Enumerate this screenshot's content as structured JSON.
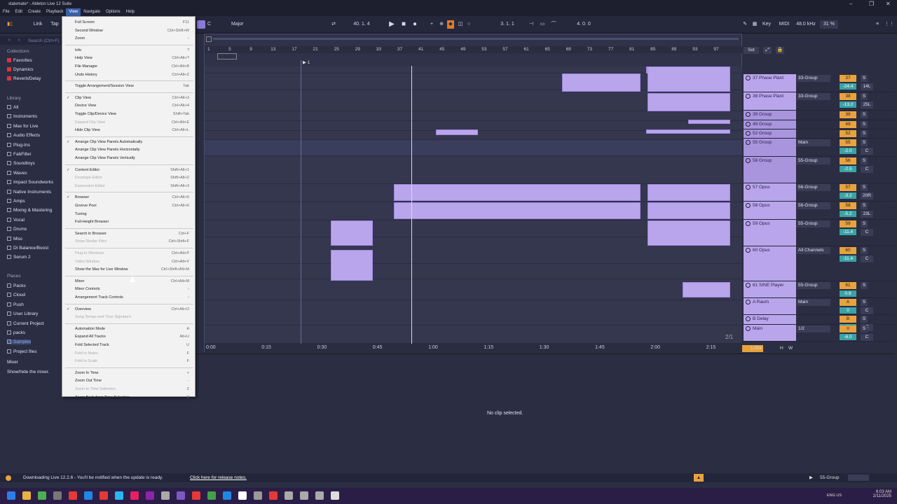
{
  "titlebar": {
    "title": "stalemate* - Ableton Live 12 Suite",
    "min": "–",
    "max": "❐",
    "close": "✕"
  },
  "menubar": [
    "File",
    "Edit",
    "Create",
    "Playback",
    "View",
    "Navigate",
    "Options",
    "Help"
  ],
  "toolbar": {
    "link": "Link",
    "tap": "Tap",
    "key": "C",
    "scale": "Major",
    "position": "40. 1. 4",
    "loop_start": "3. 1. 1",
    "loop_length": "4. 0. 0",
    "key_label": "Key",
    "midi_label": "MIDI",
    "sample_rate": "48.0 kHz",
    "cpu": "31 %"
  },
  "browser": {
    "search_placeholder": "Search (Ctrl+F)",
    "collections_header": "Collections",
    "collections": [
      {
        "label": "Favorites",
        "color": "#e0333a"
      },
      {
        "label": "Dynamics",
        "color": "#e0333a"
      },
      {
        "label": "Reverb/Delay",
        "color": "#e0333a"
      }
    ],
    "library_header": "Library",
    "library": [
      "All",
      "Instruments",
      "Max for Live",
      "Audio Effects",
      "Plug-Ins",
      "FabFilter",
      "Soundtoys",
      "Waves",
      "Impact Soundworks",
      "Native Instruments",
      "Amps",
      "Mixing & Mastering",
      "Vocal",
      "Drums",
      "Misc",
      "DI Balance/Boost",
      "Serum 2"
    ],
    "places_header": "Places",
    "places": [
      "Packs",
      "Cloud",
      "Push",
      "User Library",
      "Current Project",
      "packs",
      "Samples",
      "Project files"
    ],
    "mixer_header": "Mixer",
    "mixer_text": "Show/hide the mixer."
  },
  "ruler": {
    "bars": [
      "1",
      "5",
      "9",
      "13",
      "17",
      "21",
      "25",
      "29",
      "33",
      "37",
      "41",
      "45",
      "49",
      "53",
      "57",
      "61",
      "65",
      "69",
      "73",
      "77",
      "81",
      "85",
      "89",
      "93",
      "97"
    ],
    "times": [
      "0:00",
      "0:15",
      "0:30",
      "0:45",
      "1:00",
      "1:15",
      "1:30",
      "1:45",
      "2:00",
      "2:15"
    ],
    "set_label": "Set",
    "page": "2/1",
    "zoom": "1.00x"
  },
  "tracks": [
    {
      "name": "37 Phase Plant",
      "route": "33-Group",
      "num": "37",
      "vol": "-24.4",
      "pan": "14L",
      "group": false
    },
    {
      "name": "38 Phase Plant",
      "route": "33-Group",
      "num": "38",
      "vol": "-13.2",
      "pan": "25L",
      "group": false
    },
    {
      "name": "39 Group",
      "route": "",
      "num": "39",
      "vol": "",
      "pan": "",
      "group": true
    },
    {
      "name": "49 Group",
      "route": "",
      "num": "49",
      "vol": "",
      "pan": "",
      "group": true
    },
    {
      "name": "52 Group",
      "route": "",
      "num": "52",
      "vol": "",
      "pan": "",
      "group": true
    },
    {
      "name": "55 Group",
      "route": "Main",
      "num": "55",
      "vol": "-2.0",
      "pan": "C",
      "group": true
    },
    {
      "name": "56 Group",
      "route": "55-Group",
      "num": "56",
      "vol": "-2.5",
      "pan": "C",
      "group": true
    },
    {
      "name": "57 Opus",
      "route": "56-Group",
      "num": "57",
      "vol": "-3.2",
      "pan": "20R",
      "group": false
    },
    {
      "name": "58 Opus",
      "route": "56-Group",
      "num": "58",
      "vol": "-5.2",
      "pan": "23L",
      "group": false
    },
    {
      "name": "59 Opus",
      "route": "55-Group",
      "num": "59",
      "vol": "-11.4",
      "pan": "C",
      "group": false
    },
    {
      "name": "60 Opus",
      "route": "All Channels",
      "num": "60",
      "vol": "-11.4",
      "pan": "C",
      "group": false
    },
    {
      "name": "61 SINE Player",
      "route": "55-Group",
      "num": "61",
      "vol": "0.9",
      "pan": "",
      "group": false
    },
    {
      "name": "A Raum",
      "route": "Main",
      "num": "A",
      "vol": "0",
      "pan": "C",
      "group": false
    },
    {
      "name": "B Delay",
      "route": "",
      "num": "B",
      "vol": "0",
      "pan": "C",
      "group": false
    },
    {
      "name": "Main",
      "route": "1/2",
      "num": "0",
      "vol": "-6.0",
      "pan": "C",
      "group": false
    }
  ],
  "detail": {
    "no_clip": "No clip selected."
  },
  "status": {
    "message": "Downloading Live 12.2.6 - You'll be notified when the update is ready.",
    "link": "Click here for release notes.",
    "track": "55-Group"
  },
  "taskbar": {
    "time": "6:03 AM",
    "date": "2/11/2025",
    "lang": "ENG US"
  },
  "view_menu": [
    {
      "label": "Full Screen",
      "sc": "F11",
      "dis": false,
      "chk": false
    },
    {
      "label": "Second Window",
      "sc": "Ctrl+Shift+W",
      "dis": false,
      "chk": false
    },
    {
      "label": "Zoom",
      "sc": "›",
      "dis": false,
      "chk": false
    },
    {
      "sep": true
    },
    {
      "label": "Info",
      "sc": "?",
      "dis": false,
      "chk": false
    },
    {
      "label": "Help View",
      "sc": "Ctrl+Alt+?",
      "dis": false,
      "chk": false
    },
    {
      "label": "File Manager",
      "sc": "Ctrl+Alt+B",
      "dis": false,
      "chk": false
    },
    {
      "label": "Undo History",
      "sc": "Ctrl+Alt+Z",
      "dis": false,
      "chk": false
    },
    {
      "sep": true
    },
    {
      "label": "Toggle Arrangement/Session View",
      "sc": "Tab",
      "dis": false,
      "chk": false
    },
    {
      "sep": true
    },
    {
      "label": "Clip View",
      "sc": "Ctrl+Alt+3",
      "dis": false,
      "chk": true
    },
    {
      "label": "Device View",
      "sc": "Ctrl+Alt+4",
      "dis": false,
      "chk": false
    },
    {
      "label": "Toggle Clip/Device View",
      "sc": "Shift+Tab",
      "dis": false,
      "chk": false
    },
    {
      "label": "Expand Clip View",
      "sc": "Ctrl+Alt+E",
      "dis": true,
      "chk": false
    },
    {
      "label": "Hide Clip View",
      "sc": "Ctrl+Alt+L",
      "dis": false,
      "chk": false
    },
    {
      "sep": true
    },
    {
      "label": "Arrange Clip View Panels Automatically",
      "sc": "",
      "dis": false,
      "chk": true
    },
    {
      "label": "Arrange Clip View Panels Horizontally",
      "sc": "",
      "dis": false,
      "chk": false
    },
    {
      "label": "Arrange Clip View Panels Vertically",
      "sc": "",
      "dis": false,
      "chk": false
    },
    {
      "sep": true
    },
    {
      "label": "Content Editor",
      "sc": "Shift+Alt+1",
      "dis": false,
      "chk": true
    },
    {
      "label": "Envelope Editor",
      "sc": "Shift+Alt+2",
      "dis": true,
      "chk": false
    },
    {
      "label": "Expression Editor",
      "sc": "Shift+Alt+3",
      "dis": true,
      "chk": false
    },
    {
      "sep": true
    },
    {
      "label": "Browser",
      "sc": "Ctrl+Alt+5",
      "dis": false,
      "chk": true
    },
    {
      "label": "Groove Pool",
      "sc": "Ctrl+Alt+6",
      "dis": false,
      "chk": false
    },
    {
      "label": "Tuning",
      "sc": "",
      "dis": false,
      "chk": false
    },
    {
      "label": "Full-Height Browser",
      "sc": "",
      "dis": false,
      "chk": false
    },
    {
      "sep": true
    },
    {
      "label": "Search in Browser",
      "sc": "Ctrl+F",
      "dis": false,
      "chk": false
    },
    {
      "label": "Show Similar Files",
      "sc": "Ctrl+Shift+F",
      "dis": true,
      "chk": false
    },
    {
      "sep": true
    },
    {
      "label": "Plug-In Windows",
      "sc": "Ctrl+Alt+P",
      "dis": true,
      "chk": false
    },
    {
      "label": "Video Window",
      "sc": "Ctrl+Alt+V",
      "dis": true,
      "chk": false
    },
    {
      "label": "Show the Max for Live Window",
      "sc": "Ctrl+Shift+Alt+M",
      "dis": false,
      "chk": false
    },
    {
      "sep": true
    },
    {
      "label": "Mixer",
      "sc": "Ctrl+Alt+M",
      "dis": false,
      "chk": false
    },
    {
      "label": "Mixer Controls",
      "sc": "›",
      "dis": false,
      "chk": false
    },
    {
      "label": "Arrangement Track Controls",
      "sc": "›",
      "dis": false,
      "chk": false
    },
    {
      "sep": true
    },
    {
      "label": "Overview",
      "sc": "Ctrl+Alt+O",
      "dis": false,
      "chk": true
    },
    {
      "label": "Song Tempo and Time Signature",
      "sc": "",
      "dis": true,
      "chk": false
    },
    {
      "sep": true
    },
    {
      "label": "Automation Mode",
      "sc": "A",
      "dis": false,
      "chk": false
    },
    {
      "label": "Expand All Tracks",
      "sc": "Alt+U",
      "dis": false,
      "chk": false
    },
    {
      "label": "Fold Selected Track",
      "sc": "U",
      "dis": false,
      "chk": false
    },
    {
      "label": "Fold to Notes",
      "sc": "F",
      "dis": true,
      "chk": false
    },
    {
      "label": "Fold to Scale",
      "sc": "F",
      "dis": true,
      "chk": false
    },
    {
      "sep": true
    },
    {
      "label": "Zoom In Time",
      "sc": "+",
      "dis": false,
      "chk": false
    },
    {
      "label": "Zoom Out Time",
      "sc": "-",
      "dis": false,
      "chk": false
    },
    {
      "label": "Zoom to Time Selection",
      "sc": "Z",
      "dis": true,
      "chk": false
    },
    {
      "label": "Zoom Back from Time Selection",
      "sc": "X",
      "dis": false,
      "chk": false
    }
  ]
}
